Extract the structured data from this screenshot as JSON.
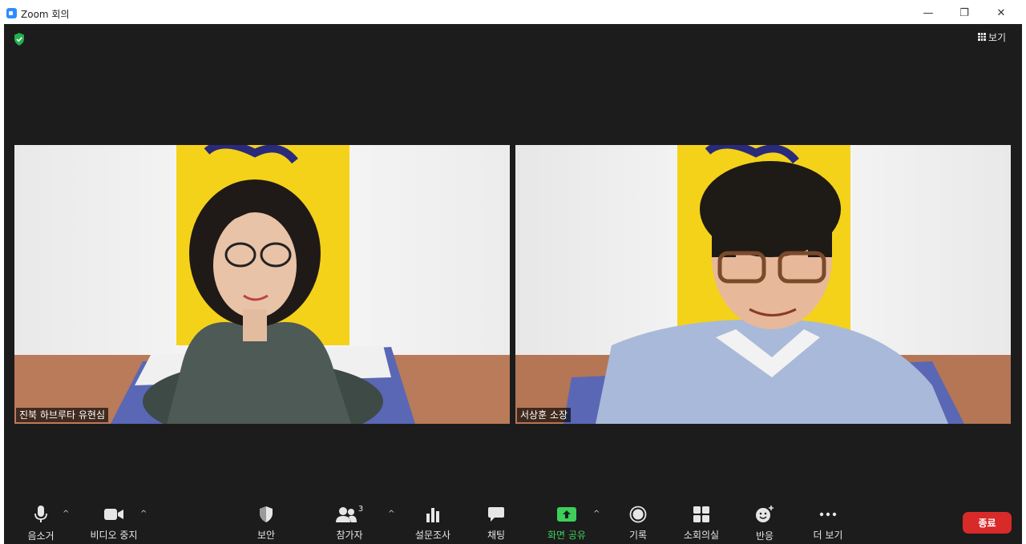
{
  "window": {
    "title": "Zoom 회의",
    "minimize_glyph": "—",
    "restore_glyph": "❐",
    "close_glyph": "✕"
  },
  "meeting": {
    "view_label": "보기",
    "security_icon": "shield-check-icon"
  },
  "participants": [
    {
      "name": "진북 하브루타 유현심"
    },
    {
      "name": "서상훈 소장"
    }
  ],
  "toolbar": {
    "mute_label": "음소거",
    "video_label": "비디오 중지",
    "security_label": "보안",
    "participants_label": "참가자",
    "participants_count": "3",
    "polls_label": "설문조사",
    "chat_label": "채팅",
    "share_label": "화면 공유",
    "record_label": "기록",
    "breakout_label": "소회의실",
    "reactions_label": "반응",
    "more_label": "더 보기",
    "end_label": "종료",
    "caret_glyph": "^"
  },
  "colors": {
    "background": "#1c1c1c",
    "share_accent": "#3ccf5a",
    "end_button": "#d92a2a",
    "secure_green": "#23b14d"
  }
}
